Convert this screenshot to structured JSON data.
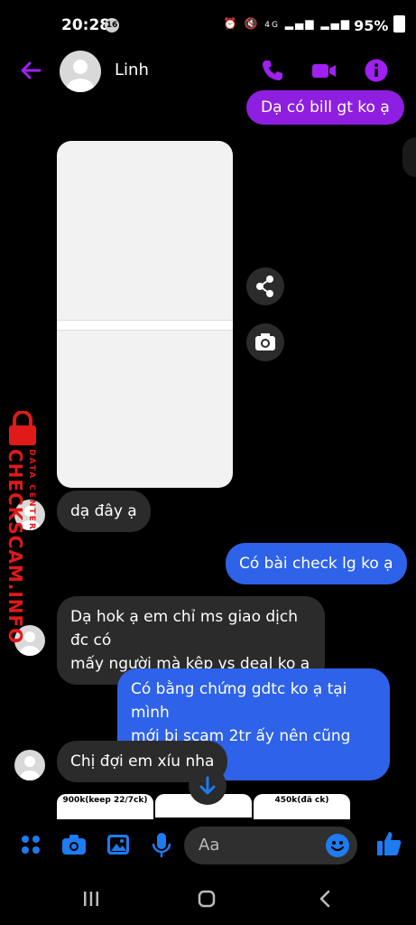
{
  "status": {
    "time": "20:28",
    "badge": "16",
    "network": "4G",
    "battery": "95%"
  },
  "header": {
    "contact_name": "Linh"
  },
  "messages": {
    "m1": "Dạ có bill gt ko ạ",
    "m2": "dạ đây ạ",
    "m3": "Có bài check lg ko ạ",
    "m4_l1": "Dạ hok ạ em chỉ ms giao dịch đc có",
    "m4_l2": "mấy người mà kêp vs deal ko ạ",
    "m5_l1": "Có bằng chứng gdtc ko ạ tại mình",
    "m5_l2": "mới bị scam 2tr ấy nên cũng rén",
    "m6": "Chị đợi em xíu nha"
  },
  "preview_cards": {
    "c1": "900k(keep 22/7ck)",
    "c3": "450k(đã ck)"
  },
  "composer": {
    "placeholder": "Aa"
  },
  "watermark": {
    "brand": "CHECKSCAM.INFO",
    "sub": "DATA CENTER"
  },
  "colors": {
    "purple": "#8f1fe0",
    "blue": "#2e62e8",
    "accent_icon": "#a020f0",
    "composer_icon": "#1e7bf0"
  }
}
